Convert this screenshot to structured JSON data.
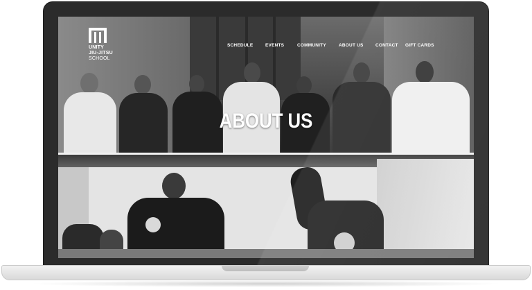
{
  "brand": {
    "logo_line1": "UNITY",
    "logo_line2": "JIU-JITSU",
    "logo_line3": "SCHOOL"
  },
  "nav": {
    "items": [
      {
        "label": "SCHEDULE"
      },
      {
        "label": "EVENTS"
      },
      {
        "label": "COMMUNITY"
      },
      {
        "label": "ABOUT US"
      },
      {
        "label": "CONTACT"
      },
      {
        "label": "GIFT CARDS"
      }
    ]
  },
  "hero": {
    "title": "ABOUT US"
  },
  "colors": {
    "text": "#ffffff",
    "laptop_frame": "#2b2b2b",
    "laptop_base": "#e6e6e6"
  }
}
